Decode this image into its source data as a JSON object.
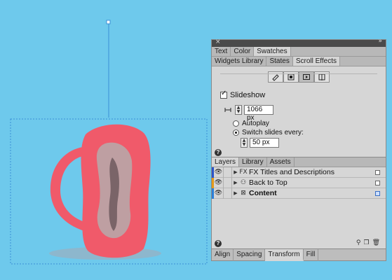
{
  "panel_top": {
    "tabs_row1": [
      "Text",
      "Color",
      "Swatches"
    ],
    "tabs_row2": [
      "Widgets Library",
      "States",
      "Scroll Effects"
    ],
    "slideshow_label": "Slideshow",
    "position_value": "1066 px",
    "autoplay_label": "Autoplay",
    "switch_label": "Switch slides every:",
    "switch_value": "50 px",
    "help": "?"
  },
  "panel_mid": {
    "tabs": [
      "Layers",
      "Library",
      "Assets"
    ],
    "layers": [
      {
        "name": "FX Titles and Descriptions",
        "color": "#2b54c8",
        "icon": "group-icon"
      },
      {
        "name": "Back to Top",
        "color": "#e39a1b",
        "icon": "people-icon"
      },
      {
        "name": "Content",
        "color": "#2b7fd8",
        "icon": "page-icon"
      }
    ],
    "help": "?"
  },
  "panel_bottom": {
    "tabs": [
      "Align",
      "Spacing",
      "Transform",
      "Fill"
    ]
  },
  "colors": {
    "canvas_bg": "#6ec9ec",
    "artwork_pink": "#f05a6a",
    "selection_blue": "#3a8fd6"
  }
}
